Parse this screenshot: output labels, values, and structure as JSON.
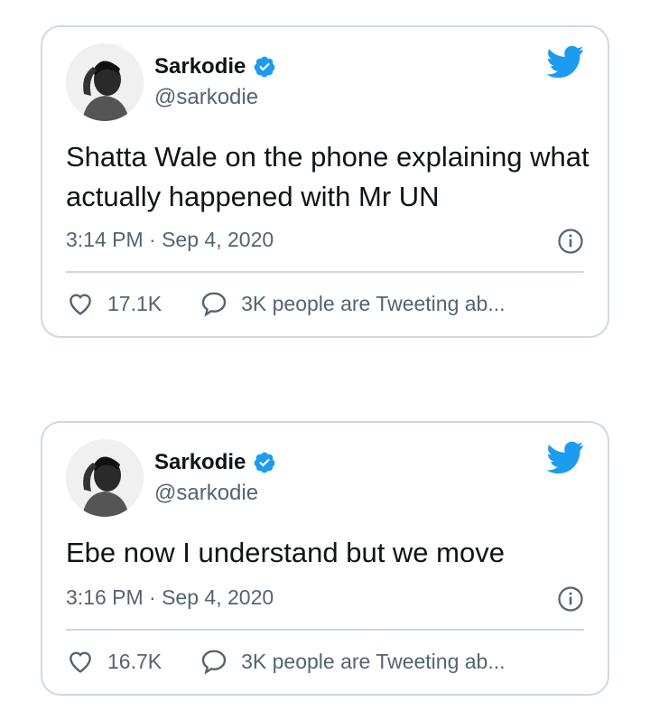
{
  "tweets": [
    {
      "name": "Sarkodie",
      "handle": "@sarkodie",
      "text": "Shatta Wale on the phone explaining what actually happened with Mr UN",
      "timestamp": "3:14 PM · Sep 4, 2020",
      "likes": "17.1K",
      "replies_text": "3K people are Tweeting ab..."
    },
    {
      "name": "Sarkodie",
      "handle": "@sarkodie",
      "text": "Ebe now I understand but we move",
      "timestamp": "3:16 PM · Sep 4, 2020",
      "likes": "16.7K",
      "replies_text": "3K people are Tweeting ab..."
    }
  ],
  "icons": {
    "logo": "twitter-bird-icon",
    "verified": "verified-badge-icon",
    "info": "info-icon",
    "like": "heart-icon",
    "reply": "speech-bubble-icon"
  },
  "colors": {
    "brand": "#1d9bf0",
    "text": "#0f1419",
    "secondary": "#536471",
    "border": "#cfd9de"
  }
}
